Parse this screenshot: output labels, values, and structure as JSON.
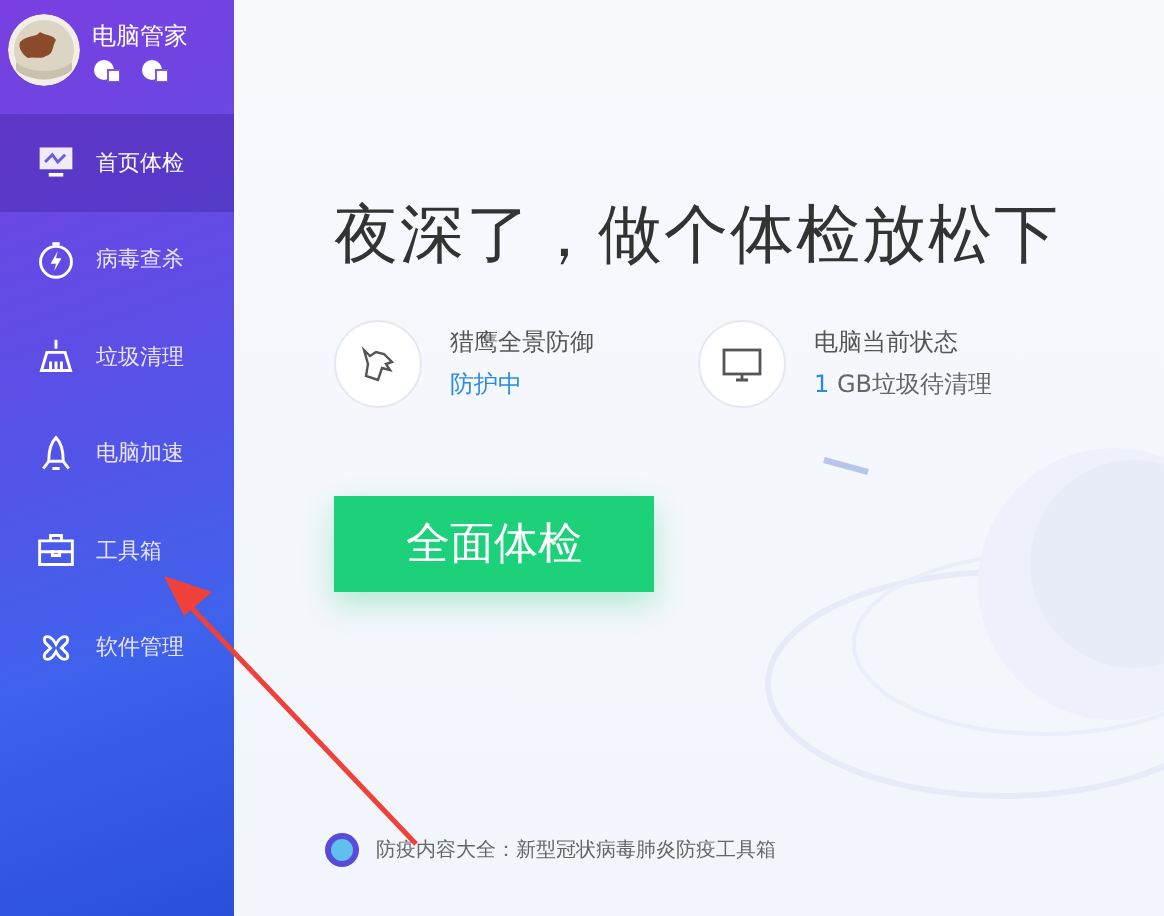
{
  "user": {
    "name": "电脑管家"
  },
  "sidebar": {
    "items": [
      {
        "label": "首页体检",
        "kind": "monitor",
        "selected": true
      },
      {
        "label": "病毒查杀",
        "kind": "bolt",
        "selected": false
      },
      {
        "label": "垃圾清理",
        "kind": "broom",
        "selected": false
      },
      {
        "label": "电脑加速",
        "kind": "rocket",
        "selected": false
      },
      {
        "label": "工具箱",
        "kind": "toolbox",
        "selected": false
      },
      {
        "label": "软件管理",
        "kind": "apps",
        "selected": false
      }
    ]
  },
  "headline": "夜深了，做个体检放松下",
  "status_cards": [
    {
      "kind": "eagle",
      "title": "猎鹰全景防御",
      "value": "防护中"
    },
    {
      "kind": "monitor",
      "title": "电脑当前状态",
      "value": "1",
      "detail": "GB垃圾待清理"
    }
  ],
  "scan_button": "全面体检",
  "footer_link": "防疫内容大全：新型冠状病毒肺炎防疫工具箱"
}
